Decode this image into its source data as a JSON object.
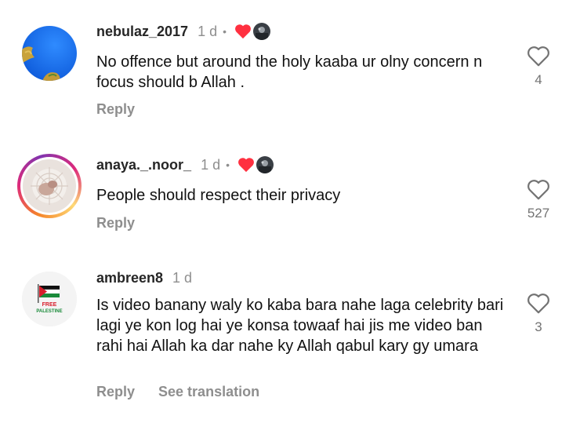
{
  "comments": [
    {
      "username": "nebulaz_2017",
      "time": "1 d",
      "dot": "•",
      "text": "No offence but around the holy kaaba ur olny concern n focus should b Allah .",
      "reply_label": "Reply",
      "likes": "4",
      "avatar_icon": "blue-sky-leaves-avatar",
      "creator_liked": true
    },
    {
      "username": "anaya._.noor_",
      "time": "1 d",
      "dot": "•",
      "text": "People should respect their privacy",
      "reply_label": "Reply",
      "likes": "527",
      "avatar_icon": "floral-story-ring-avatar",
      "creator_liked": true
    },
    {
      "username": "ambreen8",
      "time": "1 d",
      "text": "Is video banany waly ko kaba bara nahe laga celebrity bari lagi ye kon log hai ye konsa towaaf hai jis me video ban rahi hai Allah ka dar nahe ky Allah qabul kary gy umara",
      "reply_label": "Reply",
      "translate_label": "See translation",
      "likes": "3",
      "avatar_icon": "free-palestine-flag-avatar",
      "avatar_text": [
        "FREE",
        "PALESTINE"
      ],
      "creator_liked": false
    }
  ],
  "colors": {
    "username": "#262626",
    "muted": "#8e8e8e",
    "heart_red": "#ff3040",
    "text": "#111111"
  }
}
